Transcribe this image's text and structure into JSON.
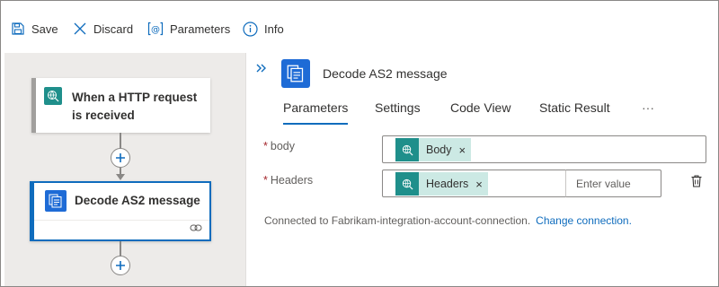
{
  "toolbar": {
    "save_label": "Save",
    "discard_label": "Discard",
    "parameters_label": "Parameters",
    "info_label": "Info"
  },
  "canvas": {
    "trigger_card": {
      "title": "When a HTTP request is received",
      "icon": "globe-icon"
    },
    "action_card": {
      "title": "Decode AS2 message",
      "icon": "as2-icon"
    }
  },
  "panel": {
    "title": "Decode AS2 message",
    "tabs": [
      {
        "label": "Parameters",
        "active": true
      },
      {
        "label": "Settings",
        "active": false
      },
      {
        "label": "Code View",
        "active": false
      },
      {
        "label": "Static Result",
        "active": false
      }
    ],
    "more_label": "···",
    "fields": {
      "body": {
        "label": "body",
        "required": true,
        "token": "Body"
      },
      "headers": {
        "label": "Headers",
        "required": true,
        "token": "Headers",
        "value_placeholder": "Enter value"
      }
    },
    "connection": {
      "text": "Connected to Fabrikam-integration-account-connection.",
      "link": "Change connection."
    }
  },
  "colors": {
    "accent": "#0f6cbd",
    "token_bg": "#cce9e4",
    "token_icon": "#1f8f8b",
    "required": "#a4262c"
  }
}
